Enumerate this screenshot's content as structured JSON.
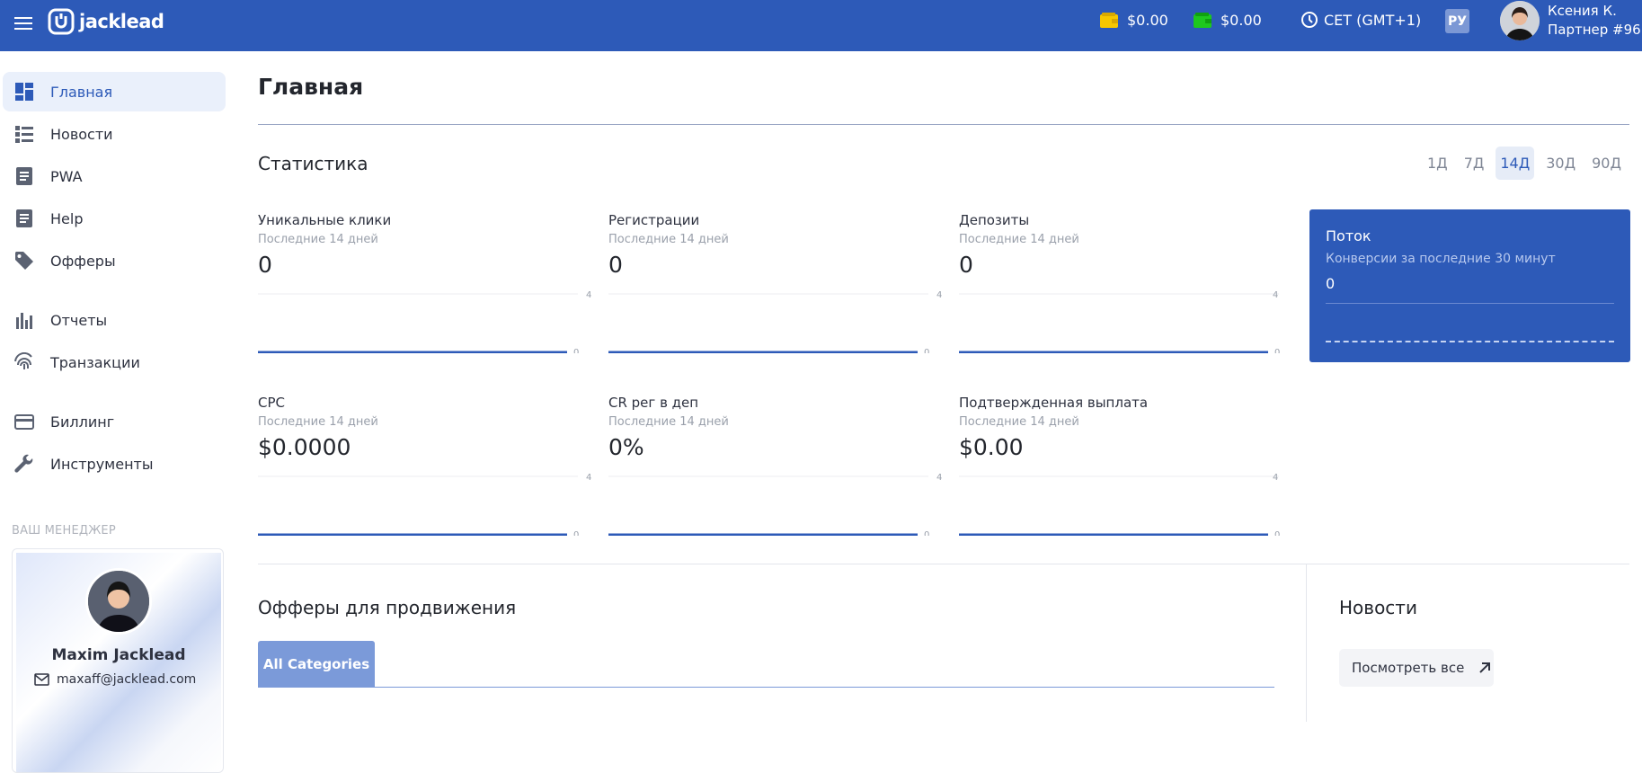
{
  "header": {
    "menu_icon": "hamburger-menu-icon",
    "logo_text": "jacklead",
    "balances": [
      {
        "icon": "wallet-yellow-icon",
        "color": "#f6c700",
        "amount": "$0.00"
      },
      {
        "icon": "wallet-green-icon",
        "color": "#1ec81e",
        "amount": "$0.00"
      }
    ],
    "timezone": "CET (GMT+1)",
    "language": "РУ",
    "user": {
      "name": "Ксения К.",
      "partner": "Партнер #96"
    }
  },
  "sidebar": {
    "items": [
      {
        "label": "Главная",
        "icon": "dashboard-icon",
        "active": true
      },
      {
        "label": "Новости",
        "icon": "news-list-icon",
        "active": false
      },
      {
        "label": "PWA",
        "icon": "document-icon",
        "active": false
      },
      {
        "label": "Help",
        "icon": "document-icon",
        "active": false
      },
      {
        "label": "Офферы",
        "icon": "tag-icon",
        "active": false
      },
      {
        "label": "Отчеты",
        "icon": "bar-chart-icon",
        "active": false
      },
      {
        "label": "Транзакции",
        "icon": "fingerprint-icon",
        "active": false
      },
      {
        "label": "Биллинг",
        "icon": "credit-card-icon",
        "active": false
      },
      {
        "label": "Инструменты",
        "icon": "wrench-icon",
        "active": false
      }
    ],
    "manager": {
      "section_title": "ВАШ МЕНЕДЖЕР",
      "name": "Maxim Jacklead",
      "email": "maxaff@jacklead.com"
    }
  },
  "main": {
    "page_title": "Главная",
    "stats": {
      "title": "Статистика",
      "periods": [
        "1Д",
        "7Д",
        "14Д",
        "30Д",
        "90Д"
      ],
      "active_period": "14Д",
      "cards": [
        {
          "label": "Уникальные клики",
          "subtitle": "Последние 14 дней",
          "value": "0",
          "axis_max": "4",
          "axis_min": "0"
        },
        {
          "label": "Регистрации",
          "subtitle": "Последние 14 дней",
          "value": "0",
          "axis_max": "4",
          "axis_min": "0"
        },
        {
          "label": "Депозиты",
          "subtitle": "Последние 14 дней",
          "value": "0",
          "axis_max": "4",
          "axis_min": "0"
        },
        {
          "label": "CPC",
          "subtitle": "Последние 14 дней",
          "value": "$0.0000",
          "axis_max": "4",
          "axis_min": "0"
        },
        {
          "label": "CR рег в деп",
          "subtitle": "Последние 14 дней",
          "value": "0%",
          "axis_max": "4",
          "axis_min": "0"
        },
        {
          "label": "Подтвержденная выплата",
          "subtitle": "Последние 14 дней",
          "value": "$0.00",
          "axis_max": "4",
          "axis_min": "0"
        }
      ]
    },
    "flow": {
      "title": "Поток",
      "subtitle": "Конверсии за последние 30 минут",
      "value": "0"
    },
    "offers": {
      "title": "Офферы для продвижения",
      "tab": "All Categories"
    },
    "news": {
      "title": "Новости",
      "view_all": "Посмотреть все"
    }
  },
  "colors": {
    "brand": "#2d5ab8",
    "active_bg": "#eaf0fb",
    "tab_bg": "#7b9ad9"
  }
}
